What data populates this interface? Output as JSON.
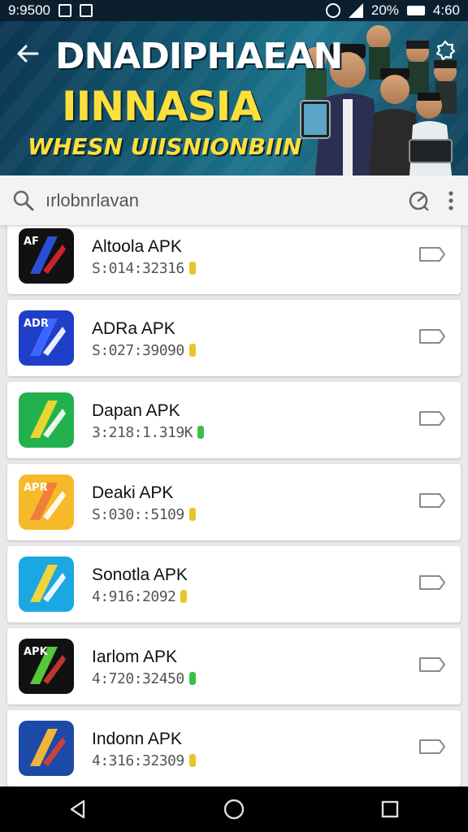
{
  "status_bar": {
    "time": "9:9500",
    "battery_text": "20%",
    "clock": "4:60"
  },
  "banner": {
    "title": "DNADIPHAEAN",
    "subtitle": "IINNASIA",
    "tagline": "WHESN UIISNIONBIIN"
  },
  "search": {
    "value": "ırlobnrlavan"
  },
  "apps": [
    {
      "name": "Altoola APK",
      "meta": "S:014:32316",
      "coin_color": "#e7c52a",
      "icon_colors": [
        "#111111",
        "#e2262c",
        "#2a4fd6"
      ],
      "icon_text": "AF"
    },
    {
      "name": "ADRa APK",
      "meta": "S:027:39090",
      "coin_color": "#e7c52a",
      "icon_colors": [
        "#1f3fc9",
        "#ffffff",
        "#3d66ff"
      ],
      "icon_text": "ADR"
    },
    {
      "name": "Dapan APK",
      "meta": "3:218:1.319K",
      "coin_color": "#3cbf4a",
      "icon_colors": [
        "#23b14d",
        "#ffffff",
        "#e9d531"
      ],
      "icon_text": ""
    },
    {
      "name": "Deaki APK",
      "meta": "S:030::5109",
      "coin_color": "#e7c52a",
      "icon_colors": [
        "#f6b92a",
        "#ffffff",
        "#ef7f3a"
      ],
      "icon_text": "APR"
    },
    {
      "name": "Sonotla APK",
      "meta": "4:916:2092",
      "coin_color": "#e7c52a",
      "icon_colors": [
        "#1aa7e2",
        "#ffffff",
        "#f1d33a"
      ],
      "icon_text": ""
    },
    {
      "name": "Iarlom APK",
      "meta": "4:720:32450",
      "coin_color": "#3cbf4a",
      "icon_colors": [
        "#111111",
        "#d23a2f",
        "#53c83a"
      ],
      "icon_text": "APK"
    },
    {
      "name": "Indonn APK",
      "meta": "4:316:32309",
      "coin_color": "#e7c52a",
      "icon_colors": [
        "#1d4aa8",
        "#e2402c",
        "#f0b43a"
      ],
      "icon_text": ""
    }
  ],
  "colors": {
    "banner_title": "#ffffff",
    "banner_accent": "#ffe03a",
    "nav_bar": "#000000",
    "status_bar": "#0b1f2e"
  }
}
